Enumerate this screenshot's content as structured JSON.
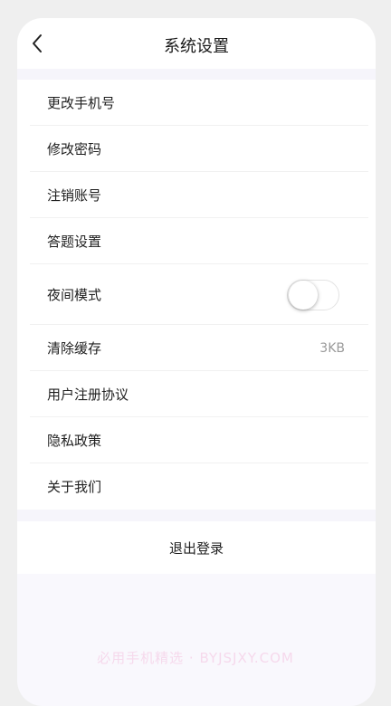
{
  "header": {
    "title": "系统设置",
    "back_icon": "chevron-left-icon"
  },
  "settings": {
    "items": [
      {
        "label": "更改手机号"
      },
      {
        "label": "修改密码"
      },
      {
        "label": "注销账号"
      },
      {
        "label": "答题设置"
      },
      {
        "label": "夜间模式",
        "toggle": false
      },
      {
        "label": "清除缓存",
        "value": "3KB"
      },
      {
        "label": "用户注册协议"
      },
      {
        "label": "隐私政策"
      },
      {
        "label": "关于我们"
      }
    ]
  },
  "logout": {
    "label": "退出登录"
  },
  "watermark": {
    "text": "必用手机精选 · BYJSJXY.COM"
  },
  "colors": {
    "page_bg": "#efefef",
    "card_bg": "#f9f8fd",
    "text": "#1f1f1f",
    "secondary_text": "#9a9a9a"
  }
}
